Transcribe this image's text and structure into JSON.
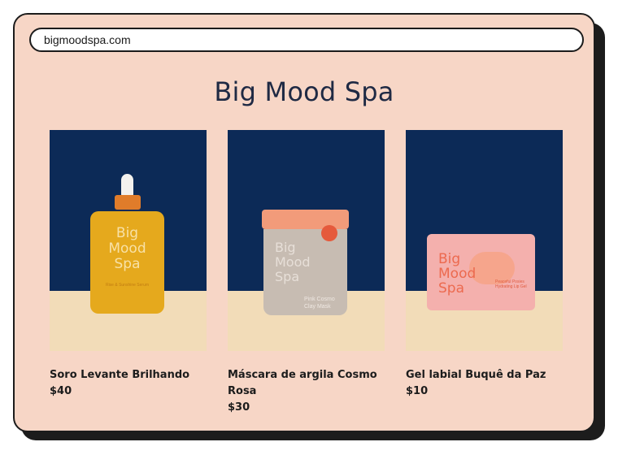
{
  "browser": {
    "url": "bigmoodspa.com"
  },
  "site": {
    "title": "Big Mood Spa"
  },
  "products": [
    {
      "name": "Soro Levante Brilhando",
      "price": "$40",
      "packaging": {
        "brand": [
          "Big",
          "Mood",
          "Spa"
        ],
        "detail": "Rise & Sunshine Serum"
      }
    },
    {
      "name": "Máscara de argila Cosmo Rosa",
      "price": "$30",
      "packaging": {
        "brand": [
          "Big",
          "Mood",
          "Spa"
        ],
        "detail_line1": "Pink Cosmo",
        "detail_line2": "Clay Mask"
      }
    },
    {
      "name": "Gel labial Buquê da Paz",
      "price": "$10",
      "packaging": {
        "brand": [
          "Big",
          "Mood",
          "Spa"
        ],
        "detail": "Peaceful Posies Hydrating Lip Gel"
      }
    }
  ],
  "colors": {
    "page_background": "#f7d6c6",
    "accent_dark": "#1c1c1c",
    "title_color": "#1f2a44",
    "product_backdrop": "#0c2a57",
    "product_floor": "#f2dcb8"
  }
}
